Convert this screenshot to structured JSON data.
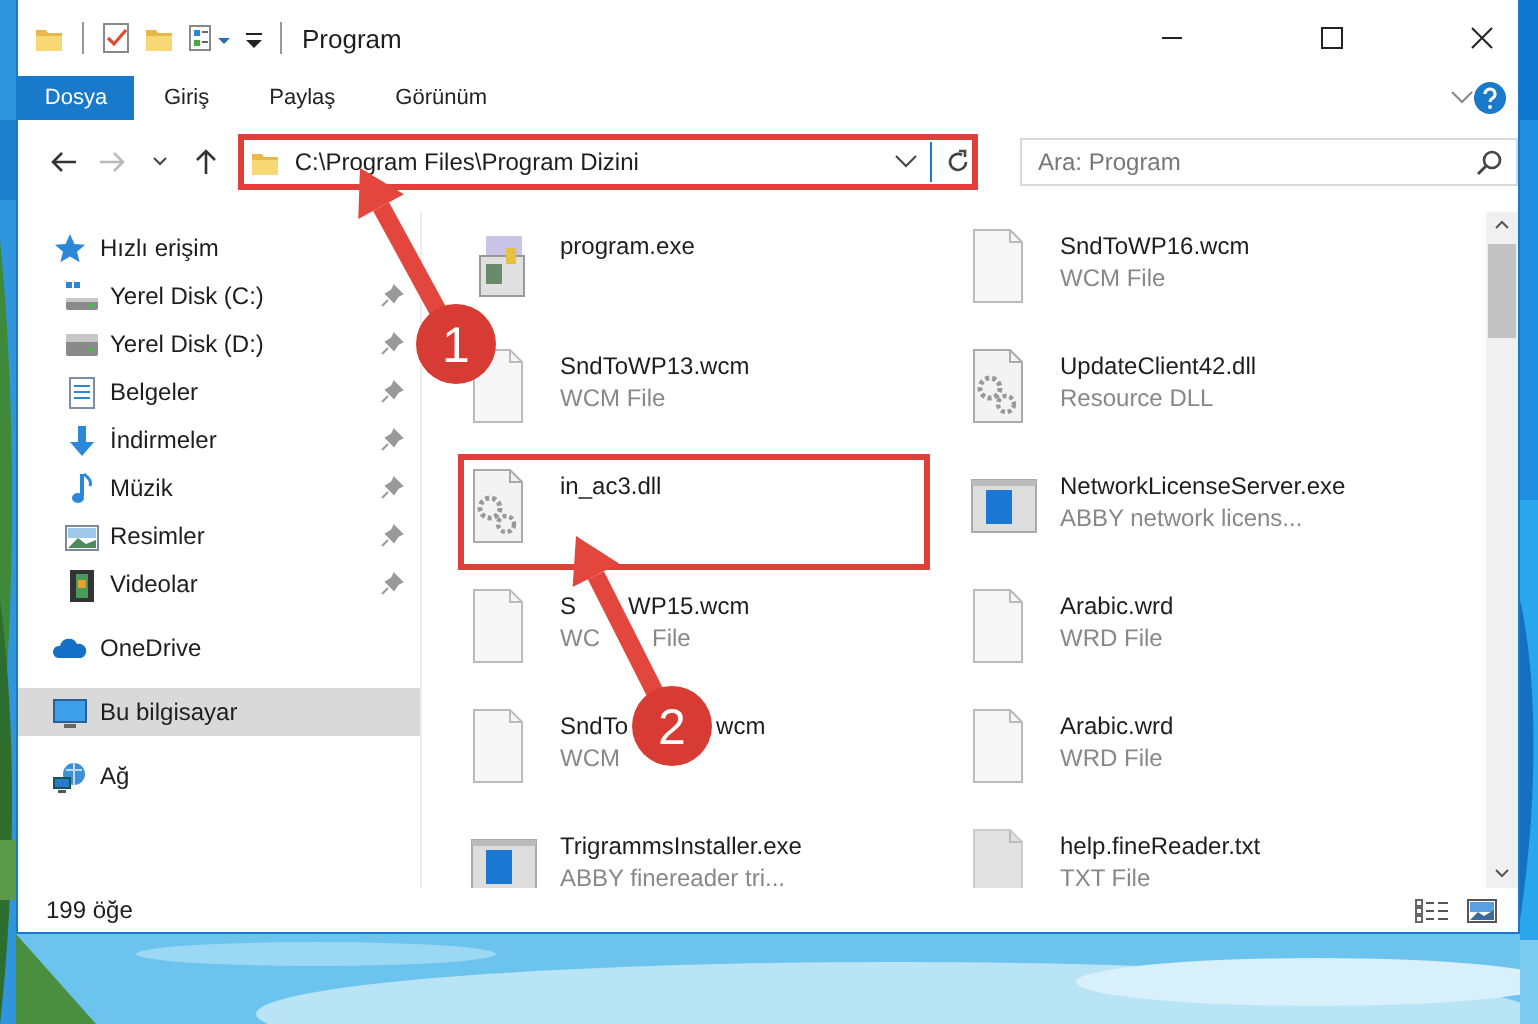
{
  "window": {
    "title": "Program"
  },
  "ribbon_tabs": [
    {
      "label": "Dosya",
      "kind": "file"
    },
    {
      "label": "Giriş",
      "kind": "tab"
    },
    {
      "label": "Paylaş",
      "kind": "tab"
    },
    {
      "label": "Görünüm",
      "kind": "tab"
    }
  ],
  "address": {
    "path": "C:\\Program Files\\Program Dizini",
    "highlighted": true
  },
  "search": {
    "placeholder": "Ara: Program"
  },
  "sidebar": {
    "items": [
      {
        "label": "Hızlı erişim",
        "kind": "star",
        "selected": false,
        "children": [
          {
            "label": "Yerel Disk (C:)",
            "kind": "system-drive",
            "pinned": true,
            "selected": false
          },
          {
            "label": "Yerel Disk (D:)",
            "kind": "drive",
            "pinned": true,
            "selected": false
          },
          {
            "label": "Belgeler",
            "kind": "documents",
            "pinned": true,
            "selected": false
          },
          {
            "label": "İndirmeler",
            "kind": "downloads",
            "pinned": true,
            "selected": false
          },
          {
            "label": "Müzik",
            "kind": "music",
            "pinned": true,
            "selected": false
          },
          {
            "label": "Resimler",
            "kind": "pictures",
            "pinned": true,
            "selected": false
          },
          {
            "label": "Videolar",
            "kind": "videos",
            "pinned": true,
            "selected": false
          }
        ]
      },
      {
        "label": "OneDrive",
        "kind": "cloud",
        "selected": false
      },
      {
        "label": "Bu bilgisayar",
        "kind": "computer",
        "selected": true
      },
      {
        "label": "Ağ",
        "kind": "network",
        "selected": false
      }
    ]
  },
  "files": [
    {
      "name": "program.exe",
      "kind": "app",
      "highlighted": false
    },
    {
      "name": "SndToWP16.wcm",
      "type": "WCM File",
      "kind": "blank",
      "highlighted": false
    },
    {
      "name": "SndToWP13.wcm",
      "type": "WCM File",
      "kind": "blank",
      "highlighted": false
    },
    {
      "name": "UpdateClient42.dll",
      "type": "Resource DLL",
      "kind": "gear",
      "highlighted": false
    },
    {
      "name": "in_ac3.dll",
      "kind": "gear",
      "highlighted": true
    },
    {
      "name": "NetworkLicenseServer.exe",
      "type": "ABBY network licens...",
      "kind": "window",
      "highlighted": false
    },
    {
      "name_parts": [
        "S",
        "WP15.wcm"
      ],
      "type_parts": [
        "WC",
        "File"
      ],
      "kind": "blank",
      "highlighted": false
    },
    {
      "name": "Arabic.wrd",
      "type": "WRD File",
      "kind": "blank",
      "highlighted": false
    },
    {
      "name_parts": [
        "SndTo",
        "wcm"
      ],
      "type_parts": [
        "WCM"
      ],
      "kind": "blank",
      "highlighted": false
    },
    {
      "name": "Arabic.wrd",
      "type": "WRD File",
      "kind": "blank",
      "highlighted": false
    },
    {
      "name": "TrigrammsInstaller.exe",
      "type": "ABBY finereader tri...",
      "kind": "window",
      "highlighted": false
    },
    {
      "name": "help.fineReader.txt",
      "type": "TXT File",
      "kind": "text",
      "highlighted": false
    }
  ],
  "status_bar": {
    "count": "199 öğe"
  },
  "annotations": [
    {
      "number": "1"
    },
    {
      "number": "2"
    }
  ]
}
